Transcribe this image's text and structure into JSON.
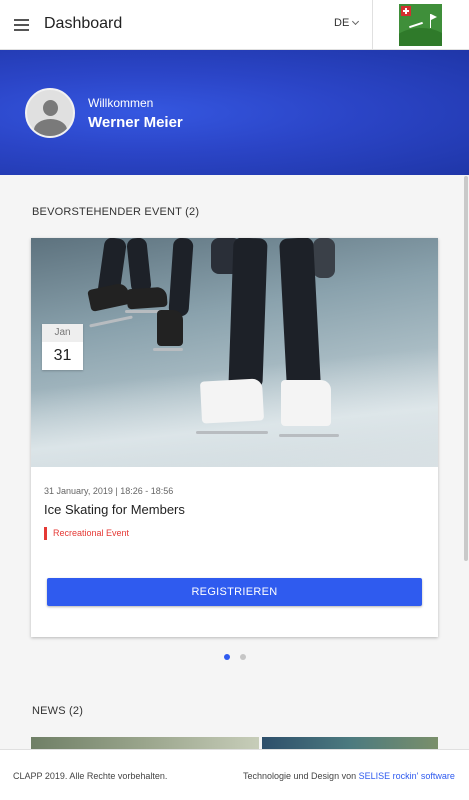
{
  "header": {
    "title": "Dashboard",
    "language": "DE"
  },
  "profile": {
    "greeting": "Willkommen",
    "name": "Werner Meier"
  },
  "events": {
    "section_title": "BEVORSTEHENDER EVENT (2)",
    "current": {
      "month": "Jan",
      "day": "31",
      "datetime": "31 January, 2019 | 18:26 - 18:56",
      "title": "Ice Skating for Members",
      "category": "Recreational Event",
      "register_label": "REGISTRIEREN"
    },
    "pagination": {
      "total": 2,
      "active": 1
    }
  },
  "news": {
    "section_title": "NEWS (2)"
  },
  "footer": {
    "copyright": "CLAPP 2019. Alle Rechte vorbehalten.",
    "credits_prefix": "Technologie und Design von",
    "credits_link": "SELISE rockin' software"
  },
  "colors": {
    "primary": "#2f5bef",
    "hero_blue": "#2b45c7",
    "tag_red": "#e53935"
  }
}
